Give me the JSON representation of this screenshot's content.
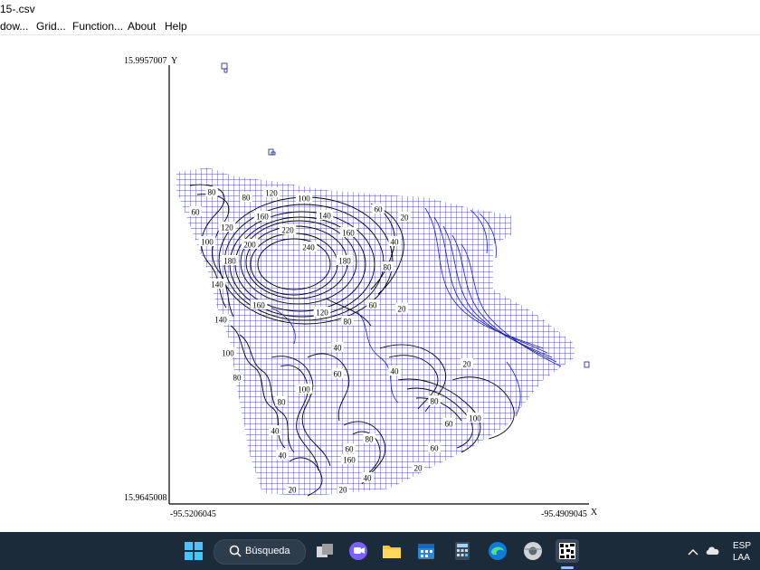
{
  "window": {
    "title": "15-.csv"
  },
  "menu": {
    "items": [
      "dow...",
      "Grid...",
      "Function...",
      "About",
      "Help"
    ]
  },
  "plot": {
    "y_max_label": "15.9957007",
    "y_axis_letter": "Y",
    "y_min_label": "15.9645008",
    "x_min_label": "-95.5206045",
    "x_max_label": "-95.4909045",
    "x_axis_letter": "X",
    "contour_labels": [
      "80",
      "80",
      "120",
      "100",
      "60",
      "160",
      "140",
      "60",
      "120",
      "220",
      "160",
      "20",
      "100",
      "200",
      "240",
      "40",
      "180",
      "180",
      "80",
      "140",
      "160",
      "120",
      "60",
      "20",
      "140",
      "80",
      "100",
      "40",
      "80",
      "20",
      "40",
      "60",
      "100",
      "80",
      "80",
      "100",
      "60",
      "40",
      "40",
      "60",
      "80",
      "60",
      "160",
      "40",
      "20",
      "20",
      "20"
    ],
    "colors": {
      "grid": "#1a1a8c",
      "contour_dark": "#000000",
      "contour_blue": "#1e1e9e"
    }
  },
  "taskbar": {
    "search_label": "Búsqueda",
    "lang_top": "ESP",
    "lang_bottom": "LAA",
    "icons": [
      "windows-start-icon",
      "search-icon",
      "task-view-icon",
      "chat-icon",
      "file-explorer-icon",
      "calendar-icon",
      "calculator-icon",
      "edge-icon",
      "chrome-icon",
      "surfer-app-icon"
    ]
  }
}
